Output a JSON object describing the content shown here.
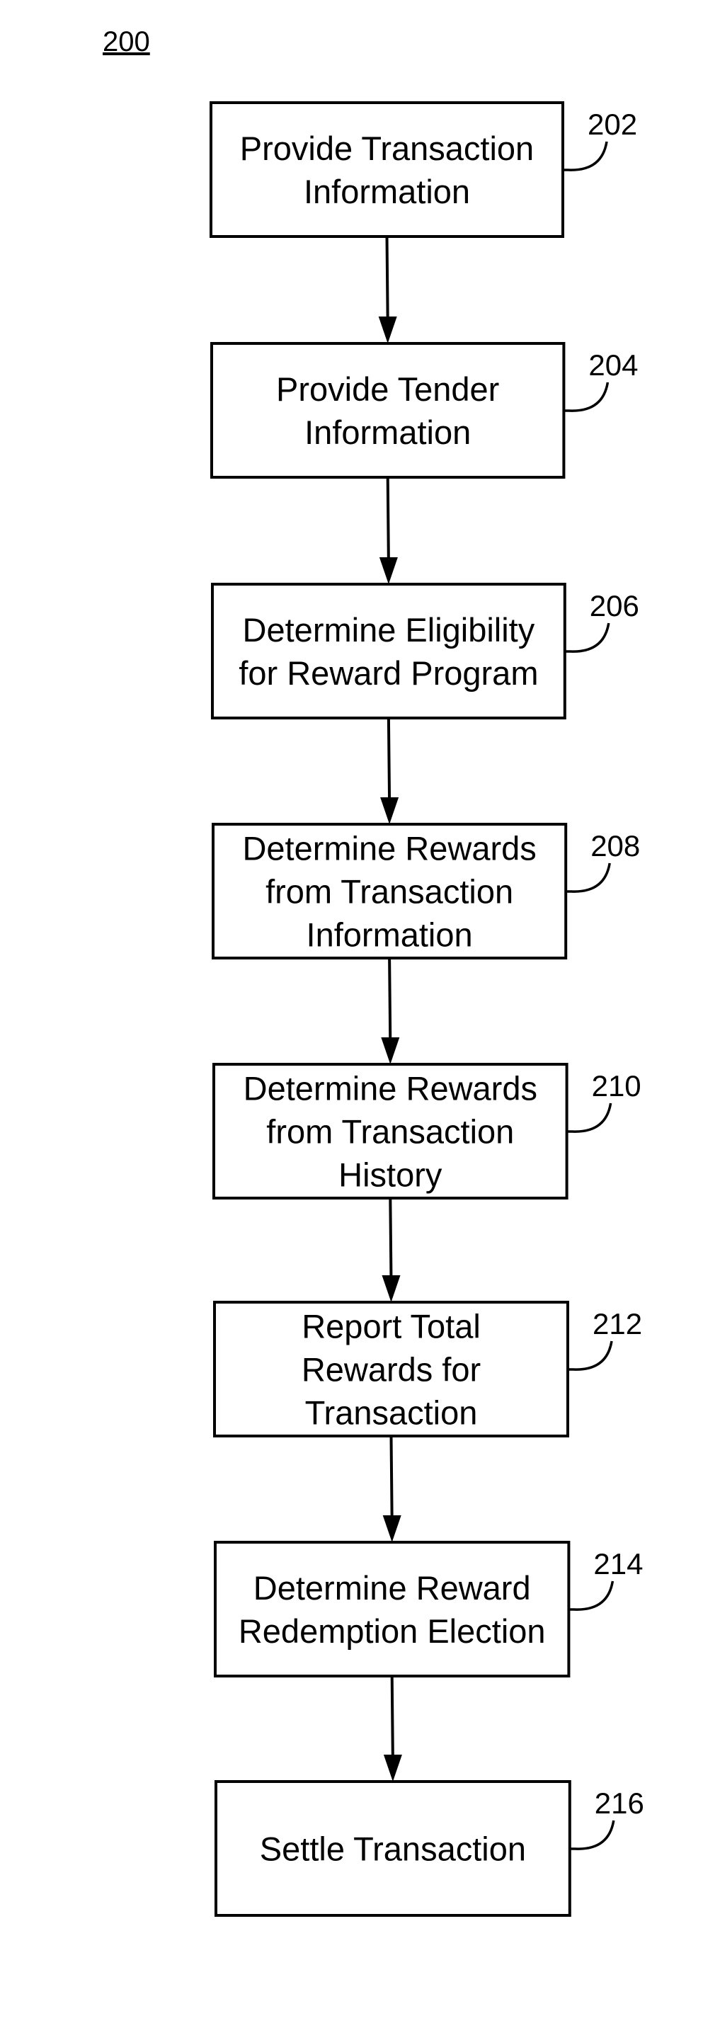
{
  "figure": {
    "label": "200"
  },
  "flow": {
    "direction": "top-to-bottom",
    "steps": [
      {
        "ref": "202",
        "lines": [
          "Provide Transaction",
          "Information"
        ]
      },
      {
        "ref": "204",
        "lines": [
          "Provide Tender",
          "Information"
        ]
      },
      {
        "ref": "206",
        "lines": [
          "Determine Eligibility",
          "for Reward Program"
        ]
      },
      {
        "ref": "208",
        "lines": [
          "Determine Rewards",
          "from Transaction",
          "Information"
        ]
      },
      {
        "ref": "210",
        "lines": [
          "Determine Rewards",
          "from Transaction",
          "History"
        ]
      },
      {
        "ref": "212",
        "lines": [
          "Report Total",
          "Rewards for",
          "Transaction"
        ]
      },
      {
        "ref": "214",
        "lines": [
          "Determine Reward",
          "Redemption Election"
        ]
      },
      {
        "ref": "216",
        "lines": [
          "Settle Transaction"
        ]
      }
    ],
    "edges": [
      {
        "from": "202",
        "to": "204"
      },
      {
        "from": "204",
        "to": "206"
      },
      {
        "from": "206",
        "to": "208"
      },
      {
        "from": "208",
        "to": "210"
      },
      {
        "from": "210",
        "to": "212"
      },
      {
        "from": "212",
        "to": "214"
      },
      {
        "from": "214",
        "to": "216"
      }
    ]
  }
}
